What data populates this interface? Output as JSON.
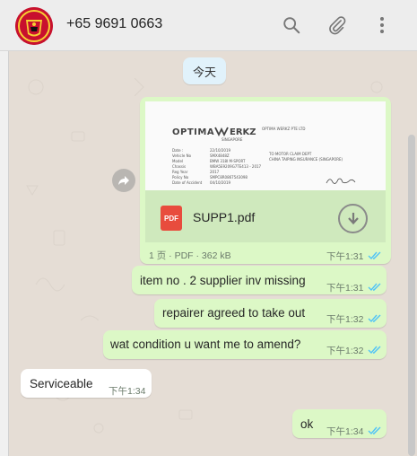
{
  "header": {
    "contact_name": "+65 9691 0663",
    "avatar_icon": "manchester-united-crest",
    "icons": [
      "search-icon",
      "attach-icon",
      "menu-icon"
    ]
  },
  "chat": {
    "date_chip": "今天",
    "messages": [
      {
        "type": "document",
        "direction": "outgoing",
        "file_name": "SUPP1.pdf",
        "file_type_badge": "PDF",
        "meta": "1 页 · PDF · 362 kB",
        "time": "下午1:31",
        "status": "read",
        "preview": {
          "brand": "OPTIMA\\\\ERKZ",
          "brand_sub": "SINGAPORE",
          "company": "OPTIMA WERKZ PTE LTD",
          "to_line": "TO MOTOR CLAIM DEPT",
          "insurer": "CHINA TAIPING INSURANCE (SINGAPORE)",
          "fields": [
            {
              "label": "Date :",
              "value": "22/10/2019"
            },
            {
              "label": "Vehicle No",
              "value": "SMX4848Z"
            },
            {
              "label": "Model",
              "value": "BMW 318I M-SPORT"
            },
            {
              "label": "Chassis",
              "value": "WBA5E9209G7TE413 - 2017"
            },
            {
              "label": "Reg Year",
              "value": "2017"
            },
            {
              "label": "Policy No",
              "value": "SMPC8R0867543098"
            },
            {
              "label": "Date of Accident",
              "value": "04/10/2019"
            }
          ]
        }
      },
      {
        "type": "text",
        "direction": "outgoing",
        "text": "item no . 2 supplier inv missing",
        "time": "下午1:31",
        "status": "read"
      },
      {
        "type": "text",
        "direction": "outgoing",
        "text": "repairer agreed to take out",
        "time": "下午1:32",
        "status": "read"
      },
      {
        "type": "text",
        "direction": "outgoing",
        "text": "wat condition u want me to amend?",
        "time": "下午1:32",
        "status": "read"
      },
      {
        "type": "text",
        "direction": "incoming",
        "text": "Serviceable",
        "time": "下午1:34"
      },
      {
        "type": "text",
        "direction": "outgoing",
        "text": "ok",
        "time": "下午1:34",
        "status": "read"
      }
    ]
  },
  "colors": {
    "outgoing_bubble": "#dcf8c6",
    "incoming_bubble": "#ffffff",
    "chat_background": "#e5ddd5",
    "read_ticks": "#4fc3f7",
    "pdf_badge": "#e84c3d"
  }
}
